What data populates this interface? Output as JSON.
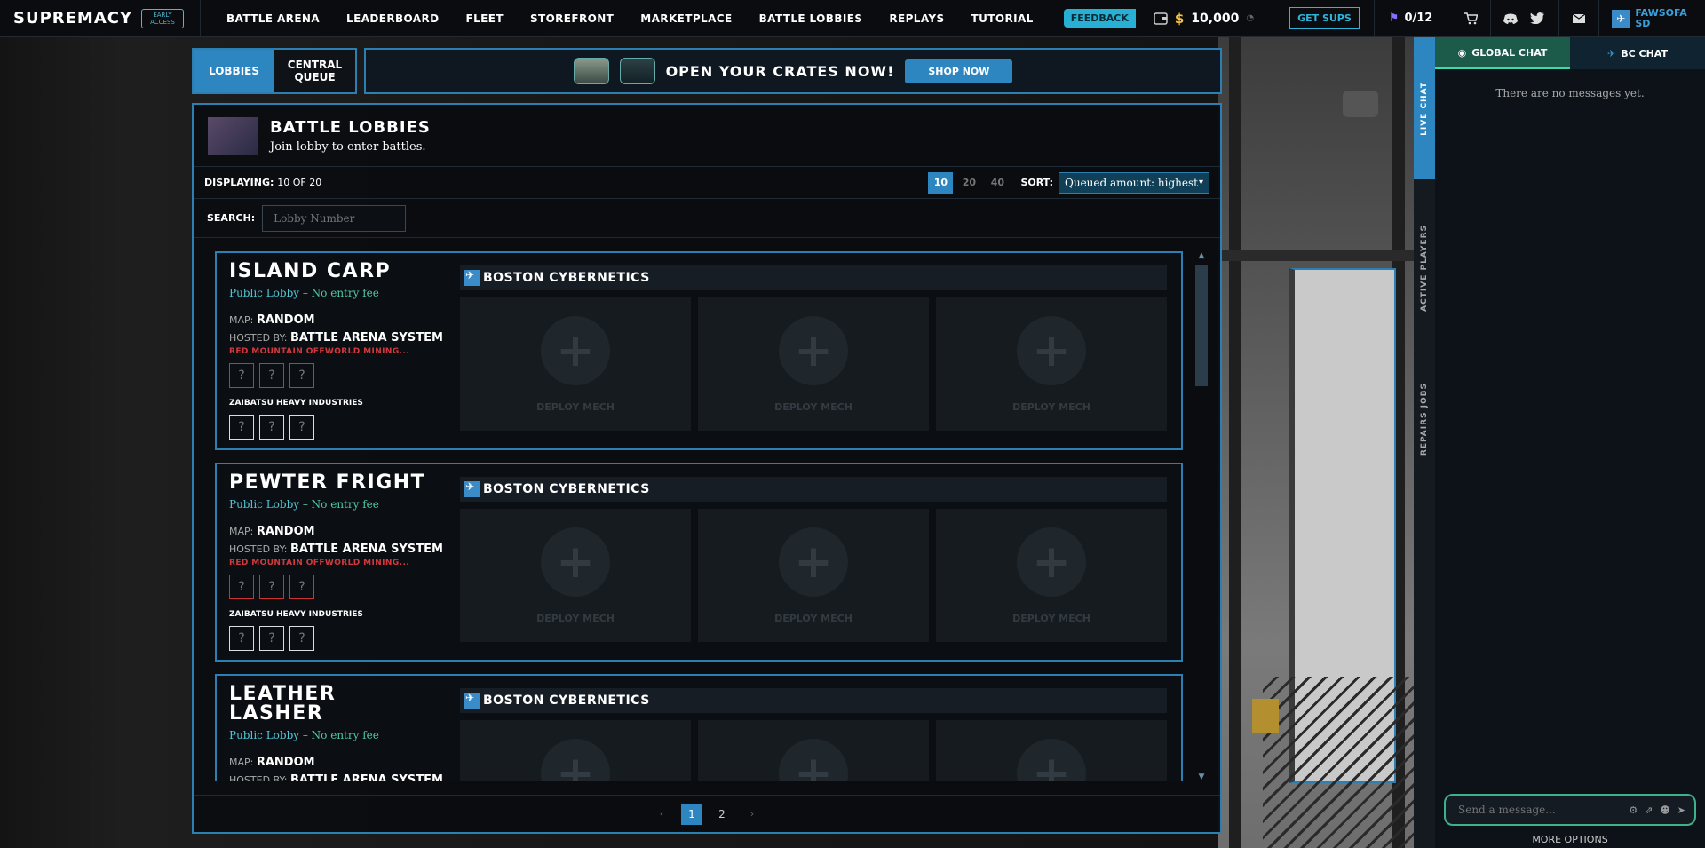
{
  "topbar": {
    "logo": "SUPREMACY",
    "early_access": "EARLY ACCESS",
    "nav": [
      "BATTLE ARENA",
      "LEADERBOARD",
      "FLEET",
      "STOREFRONT",
      "MARKETPLACE",
      "BATTLE LOBBIES",
      "REPLAYS",
      "TUTORIAL"
    ],
    "feedback": "FEEDBACK",
    "wallet_amount": "10,000",
    "get_sups": "GET SUPS",
    "flag_count": "0/12",
    "username_line1": "FAWSOFA",
    "username_line2": "SD"
  },
  "tabs": {
    "lobbies": "LOBBIES",
    "central_queue_line1": "CENTRAL",
    "central_queue_line2": "QUEUE"
  },
  "promo": {
    "title": "OPEN YOUR CRATES NOW!",
    "button": "SHOP NOW"
  },
  "panel": {
    "title": "BATTLE LOBBIES",
    "subtitle": "Join lobby to enter battles.",
    "displaying_prefix": "DISPLAYING:",
    "displaying_value": "10 OF 20",
    "page_sizes": [
      "10",
      "20",
      "40"
    ],
    "sort_label": "SORT:",
    "sort_value": "Queued amount: highest",
    "search_label": "SEARCH:",
    "search_placeholder": "Lobby Number"
  },
  "lobby_common": {
    "type": "Public Lobby",
    "fee": "– No entry fee",
    "map_label": "MAP:",
    "map_value": "RANDOM",
    "host_label": "HOSTED BY:",
    "host_value": "BATTLE ARENA SYSTEM",
    "red_faction": "RED MOUNTAIN OFFWORLD MINING...",
    "zai_faction": "ZAIBATSU HEAVY INDUSTRIES",
    "slot_char": "?",
    "faction_name": "BOSTON CYBERNETICS",
    "deploy_text": "DEPLOY MECH"
  },
  "lobbies": [
    {
      "name_line1": "ISLAND CARP",
      "name_line2": ""
    },
    {
      "name_line1": "PEWTER FRIGHT",
      "name_line2": ""
    },
    {
      "name_line1": "LEATHER",
      "name_line2": "LASHER"
    }
  ],
  "pagination": {
    "prev": "‹",
    "pages": [
      "1",
      "2"
    ],
    "next": "›"
  },
  "side_tabs": {
    "live_chat": "LIVE CHAT",
    "active_players": "ACTIVE PLAYERS",
    "repairs_jobs": "REPAIRS JOBS"
  },
  "chat": {
    "global_tab": "GLOBAL CHAT",
    "bc_tab": "BC CHAT",
    "empty": "There are no messages yet.",
    "placeholder": "Send a message...",
    "more_options": "MORE OPTIONS"
  }
}
